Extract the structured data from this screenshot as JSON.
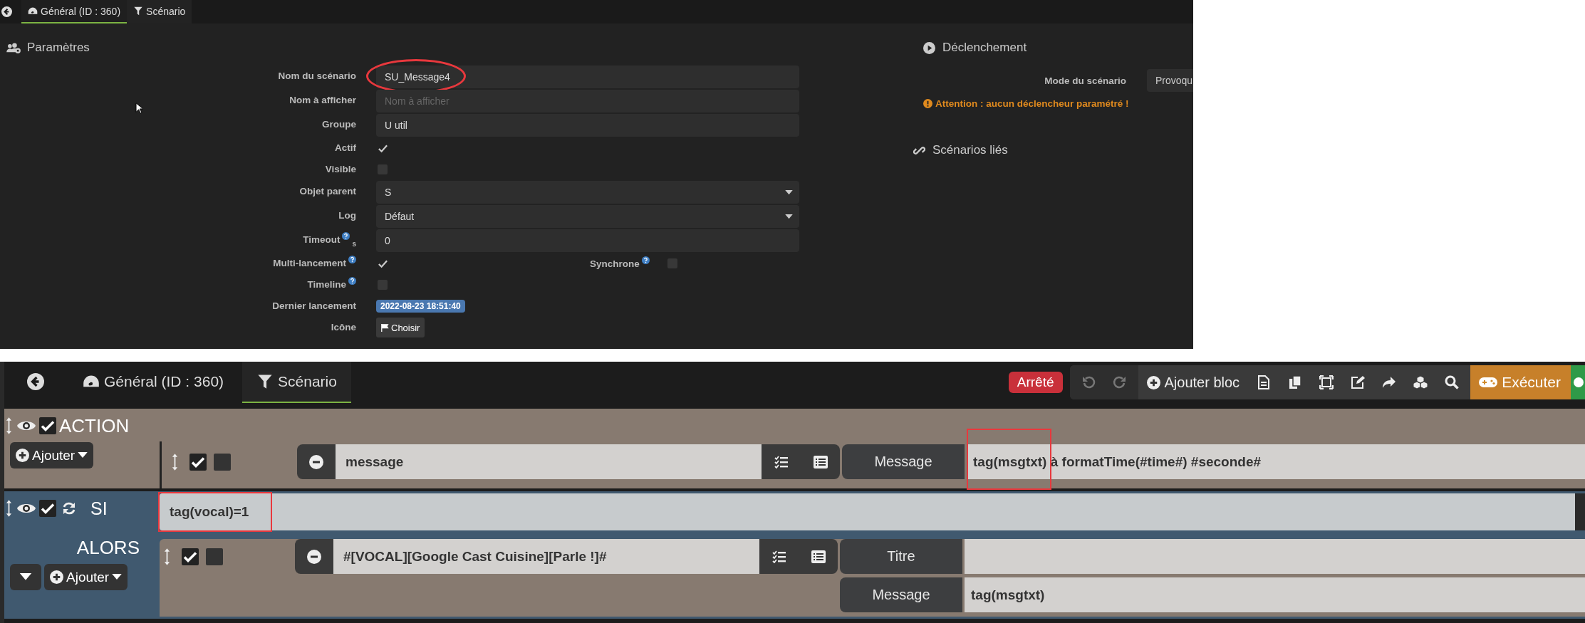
{
  "top_screenshot": {
    "tabs": [
      {
        "label": "Général (ID : 360)",
        "selected": true
      },
      {
        "label": "Scénario",
        "selected": false
      }
    ],
    "parametres": {
      "title": "Paramètres",
      "fields": [
        {
          "kind": "text",
          "label": "Nom du scénario",
          "value": "SU_Message4",
          "circled": true
        },
        {
          "kind": "text",
          "label": "Nom à afficher",
          "placeholder": "Nom à afficher"
        },
        {
          "kind": "text",
          "label": "Groupe",
          "value": "U util"
        },
        {
          "kind": "checkbox",
          "label": "Actif",
          "checked": true
        },
        {
          "kind": "checkbox",
          "label": "Visible",
          "checked": false
        },
        {
          "kind": "select",
          "label": "Objet parent",
          "value": "S"
        },
        {
          "kind": "select",
          "label": "Log",
          "value": "Défaut"
        },
        {
          "kind": "text",
          "label": "Timeout",
          "help": true,
          "unit": "s",
          "value": "0"
        },
        {
          "kind": "checkbox",
          "label": "Multi-lancement",
          "help": true,
          "checked": true,
          "extra": {
            "label": "Synchrone",
            "help": true,
            "checked": false
          }
        },
        {
          "kind": "checkbox",
          "label": "Timeline",
          "help": true,
          "checked": false
        },
        {
          "kind": "badge",
          "label": "Dernier lancement",
          "value": "2022-08-23 18:51:40"
        },
        {
          "kind": "button",
          "label": "Icône",
          "value": "Choisir"
        }
      ]
    },
    "declenchement": {
      "title": "Déclenchement",
      "mode_label": "Mode du scénario",
      "mode_value": "Provoqu",
      "warning": "Attention : aucun déclencheur paramétré !"
    },
    "linked": {
      "title": "Scénarios liés"
    }
  },
  "bottom_screenshot": {
    "tabs": [
      {
        "label": "Général (ID : 360)",
        "selected": false
      },
      {
        "label": "Scénario",
        "selected": true
      }
    ],
    "status": "Arrêté",
    "toolbar": {
      "add_block": "Ajouter bloc",
      "execute": "Exécuter"
    },
    "blocks": [
      {
        "kind": "action",
        "title": "ACTION",
        "visible": true,
        "enabled": true,
        "add_label": "Ajouter",
        "rows": [
          {
            "enabled": true,
            "parallel": false,
            "expression": "message",
            "options": [
              {
                "label": "Message",
                "value": "tag(msgtxt) à formatTime(#time#) #seconde#",
                "boxed": true
              }
            ]
          }
        ]
      },
      {
        "kind": "if",
        "title": "SI",
        "visible": true,
        "enabled": true,
        "condition": "tag(vocal)=1",
        "condition_boxed": true,
        "then_label": "ALORS",
        "add_label": "Ajouter",
        "rows": [
          {
            "enabled": true,
            "parallel": false,
            "expression": "#[VOCAL][Google Cast Cuisine][Parle !]#",
            "options": [
              {
                "label": "Titre"
              },
              {
                "label": "Message",
                "value": "tag(msgtxt)"
              }
            ]
          }
        ]
      }
    ]
  }
}
